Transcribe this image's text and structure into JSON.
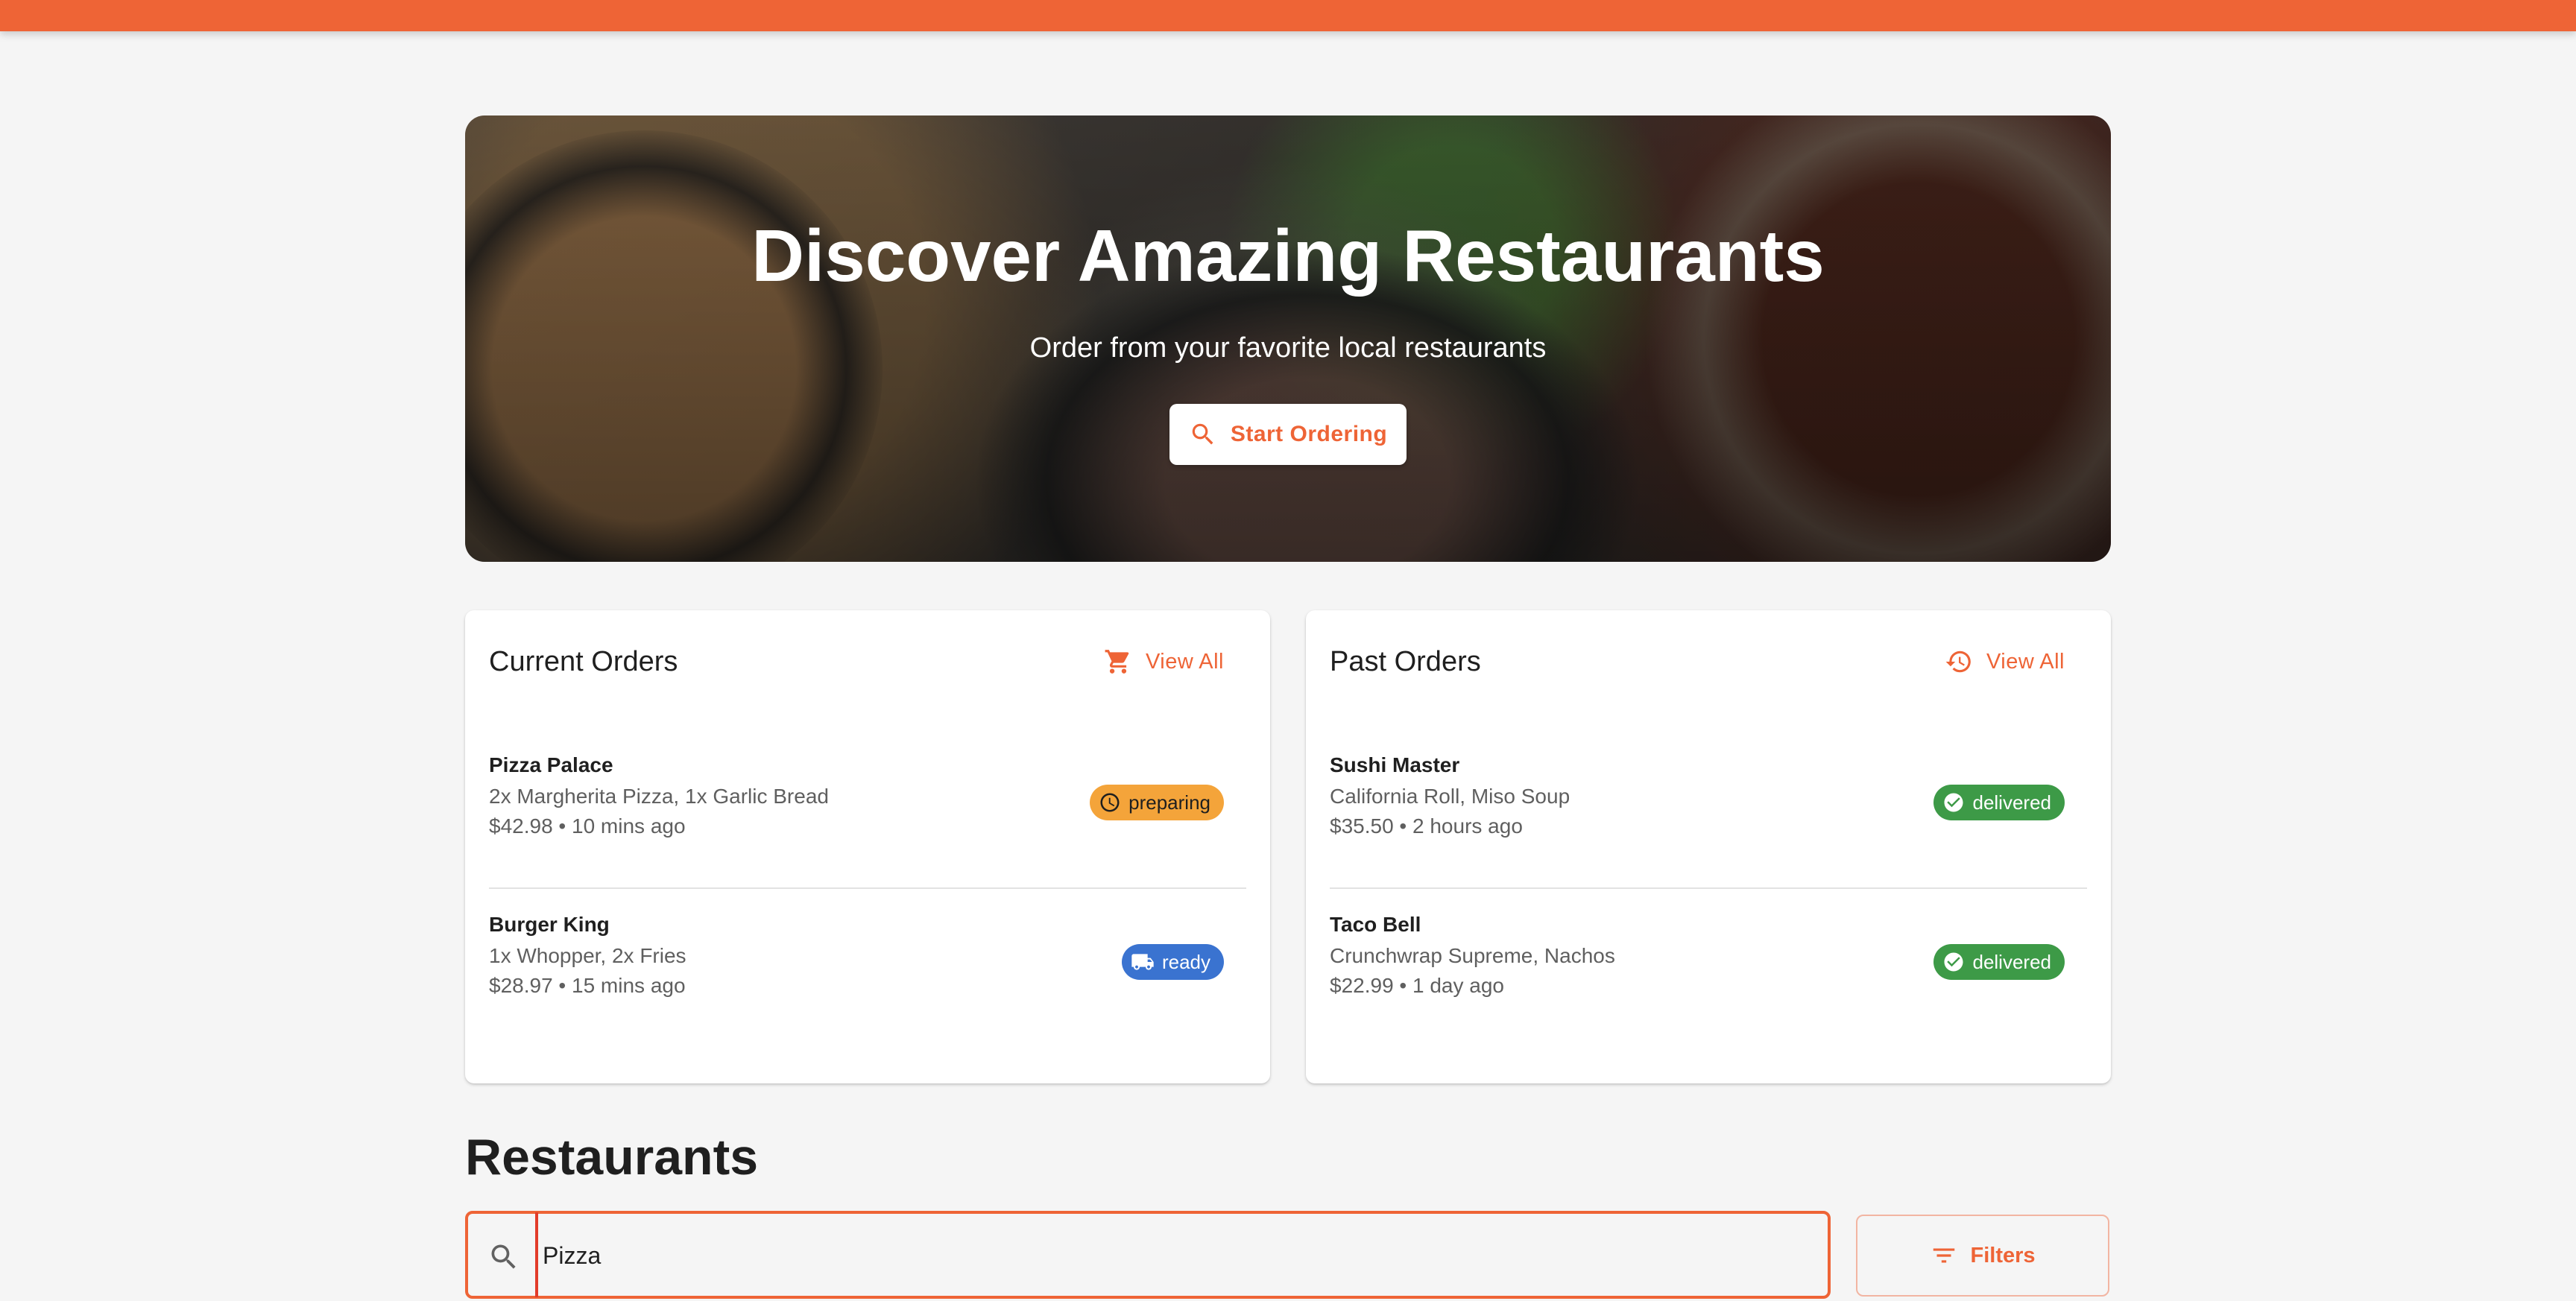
{
  "hero": {
    "title": "Discover Amazing Restaurants",
    "subtitle": "Order from your favorite local restaurants",
    "cta_label": "Start Ordering"
  },
  "current_orders": {
    "title": "Current Orders",
    "view_all_label": "View All",
    "orders": [
      {
        "restaurant": "Pizza Palace",
        "items": "2x Margherita Pizza, 1x Garlic Bread",
        "meta": "$42.98 • 10 mins ago",
        "status": "preparing"
      },
      {
        "restaurant": "Burger King",
        "items": "1x Whopper, 2x Fries",
        "meta": "$28.97 • 15 mins ago",
        "status": "ready"
      }
    ]
  },
  "past_orders": {
    "title": "Past Orders",
    "view_all_label": "View All",
    "orders": [
      {
        "restaurant": "Sushi Master",
        "items": "California Roll, Miso Soup",
        "meta": "$35.50 • 2 hours ago",
        "status": "delivered"
      },
      {
        "restaurant": "Taco Bell",
        "items": "Crunchwrap Supreme, Nachos",
        "meta": "$22.99 • 1 day ago",
        "status": "delivered"
      }
    ]
  },
  "restaurants": {
    "title": "Restaurants",
    "search_value": "Pizza",
    "filters_label": "Filters"
  },
  "colors": {
    "accent": "#ee6436",
    "preparing": "#f4a43a",
    "ready": "#3a73d0",
    "delivered": "#3d9a47"
  }
}
